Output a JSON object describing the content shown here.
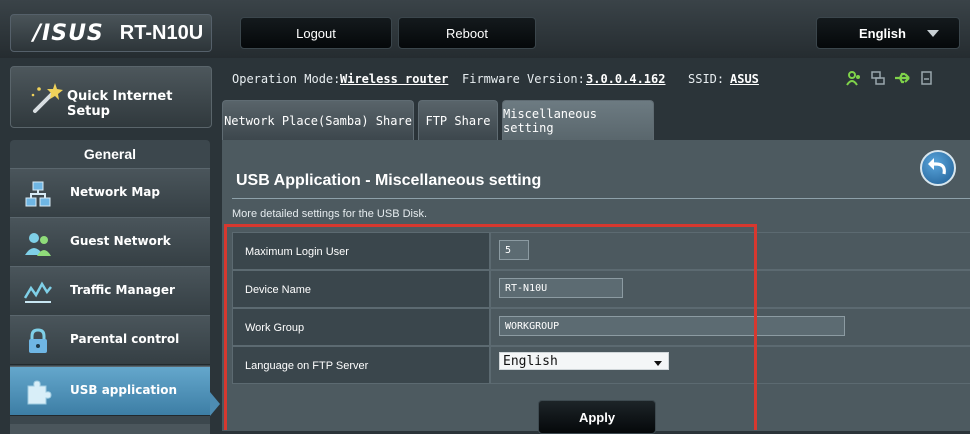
{
  "header": {
    "brand": "/ISUS",
    "model": "RT-N10U",
    "logout_label": "Logout",
    "reboot_label": "Reboot",
    "language": "English"
  },
  "sidebar": {
    "quick_setup_label": "Quick Internet Setup",
    "section_title": "General",
    "items": [
      {
        "label": "Network Map",
        "icon": "network-map-icon"
      },
      {
        "label": "Guest Network",
        "icon": "guest-network-icon"
      },
      {
        "label": "Traffic Manager",
        "icon": "traffic-manager-icon"
      },
      {
        "label": "Parental control",
        "icon": "lock-icon"
      },
      {
        "label": "USB application",
        "icon": "puzzle-icon",
        "active": true
      }
    ]
  },
  "status": {
    "operation_mode_label": "Operation Mode:",
    "operation_mode_value": "Wireless router",
    "firmware_label": "Firmware Version:",
    "firmware_value": "3.0.0.4.162",
    "ssid_label": "SSID:",
    "ssid_value": "ASUS",
    "status_icons": [
      "clients-icon",
      "network-icon",
      "usb-icon",
      "printer-icon"
    ],
    "icon_colors": {
      "clients": "#7fd34a",
      "usb": "#7fd34a",
      "network": "#9aa7ae"
    }
  },
  "tabs": [
    {
      "label": "Network Place(Samba) Share"
    },
    {
      "label": "FTP Share"
    },
    {
      "label": "Miscellaneous setting",
      "active": true
    }
  ],
  "panel": {
    "title": "USB Application - Miscellaneous setting",
    "description": "More detailed settings for the USB Disk.",
    "rows": [
      {
        "label": "Maximum Login User",
        "value": "5"
      },
      {
        "label": "Device Name",
        "value": "RT-N10U"
      },
      {
        "label": "Work Group",
        "value": "WORKGROUP"
      },
      {
        "label": "Language on FTP Server",
        "value": "English"
      }
    ],
    "apply_label": "Apply"
  },
  "colors": {
    "highlight_border": "#d7382f",
    "active_nav": "#4d8cb2"
  }
}
